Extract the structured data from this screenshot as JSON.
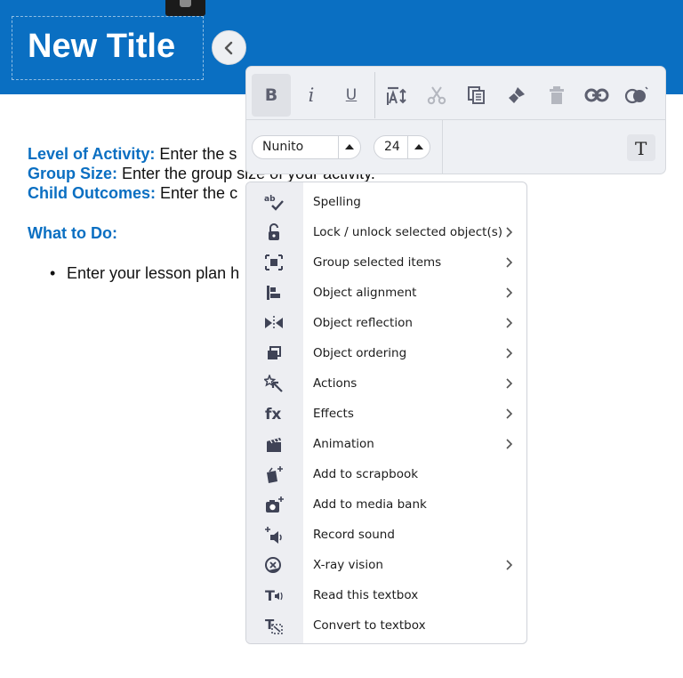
{
  "header": {
    "title": "New Title"
  },
  "content": {
    "rows": [
      {
        "label": "Level of Activity:",
        "text": " Enter the s"
      },
      {
        "label": "Group Size:",
        "text": " Enter the group size of your activity."
      },
      {
        "label": "Child Outcomes:",
        "text": " Enter the c"
      }
    ],
    "what_to_do": "What to Do:",
    "bullet": "•",
    "bullet_text": "Enter your lesson plan h"
  },
  "toolbar": {
    "font_family": "Nunito",
    "font_size": "24",
    "buttons": [
      {
        "name": "bold",
        "glyph": "B"
      },
      {
        "name": "italic",
        "glyph": "i"
      },
      {
        "name": "underline",
        "glyph": "U"
      }
    ],
    "text_style_glyph": "T"
  },
  "context_menu": {
    "items": [
      {
        "label": "Spelling",
        "icon": "spelling-icon",
        "submenu": false
      },
      {
        "label": "Lock / unlock selected object(s)",
        "icon": "lock-icon",
        "submenu": true
      },
      {
        "label": "Group selected items",
        "icon": "group-icon",
        "submenu": true
      },
      {
        "label": "Object alignment",
        "icon": "align-icon",
        "submenu": true
      },
      {
        "label": "Object reflection",
        "icon": "reflection-icon",
        "submenu": true
      },
      {
        "label": "Object ordering",
        "icon": "ordering-icon",
        "submenu": true
      },
      {
        "label": "Actions",
        "icon": "actions-icon",
        "submenu": true
      },
      {
        "label": "Effects",
        "icon": "effects-icon",
        "submenu": true
      },
      {
        "label": "Animation",
        "icon": "animation-icon",
        "submenu": true
      },
      {
        "label": "Add to scrapbook",
        "icon": "scrapbook-icon",
        "submenu": false
      },
      {
        "label": "Add to media bank",
        "icon": "media-bank-icon",
        "submenu": false
      },
      {
        "label": "Record sound",
        "icon": "record-sound-icon",
        "submenu": false
      },
      {
        "label": "X-ray vision",
        "icon": "xray-icon",
        "submenu": true
      },
      {
        "label": "Read this textbox",
        "icon": "read-textbox-icon",
        "submenu": false
      },
      {
        "label": "Convert to textbox",
        "icon": "convert-textbox-icon",
        "submenu": false
      }
    ]
  },
  "colors": {
    "banner": "#0a6fc2",
    "label_blue": "#0a6fc2",
    "icon": "#3f4356"
  }
}
